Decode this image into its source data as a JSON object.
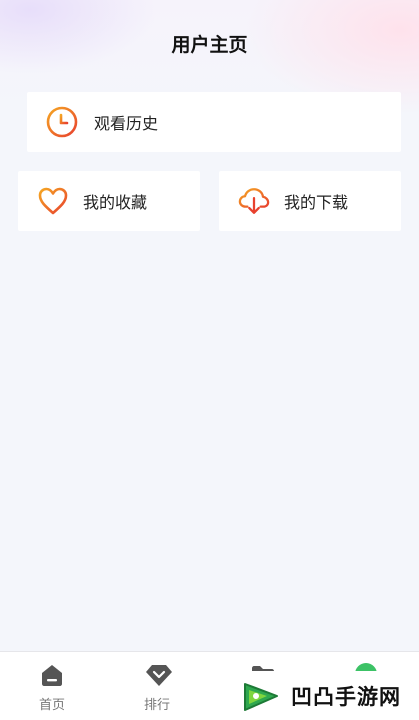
{
  "header": {
    "title": "用户主页"
  },
  "cards": {
    "history": {
      "label": "观看历史",
      "icon": "clock-icon"
    },
    "favorites": {
      "label": "我的收藏",
      "icon": "heart-icon"
    },
    "downloads": {
      "label": "我的下载",
      "icon": "cloud-download-icon"
    }
  },
  "tabbar": {
    "items": [
      {
        "label": "首页",
        "icon": "home-icon"
      },
      {
        "label": "排行",
        "icon": "ranking-icon"
      },
      {
        "label": "",
        "icon": "folder-icon"
      },
      {
        "label": "",
        "icon": "profile-icon"
      }
    ]
  },
  "watermark": {
    "text": "凹凸手游网"
  },
  "colors": {
    "accent_start": "#f5a623",
    "accent_end": "#e8412e",
    "tab_icon": "#555555",
    "active_green": "#3cc266"
  }
}
